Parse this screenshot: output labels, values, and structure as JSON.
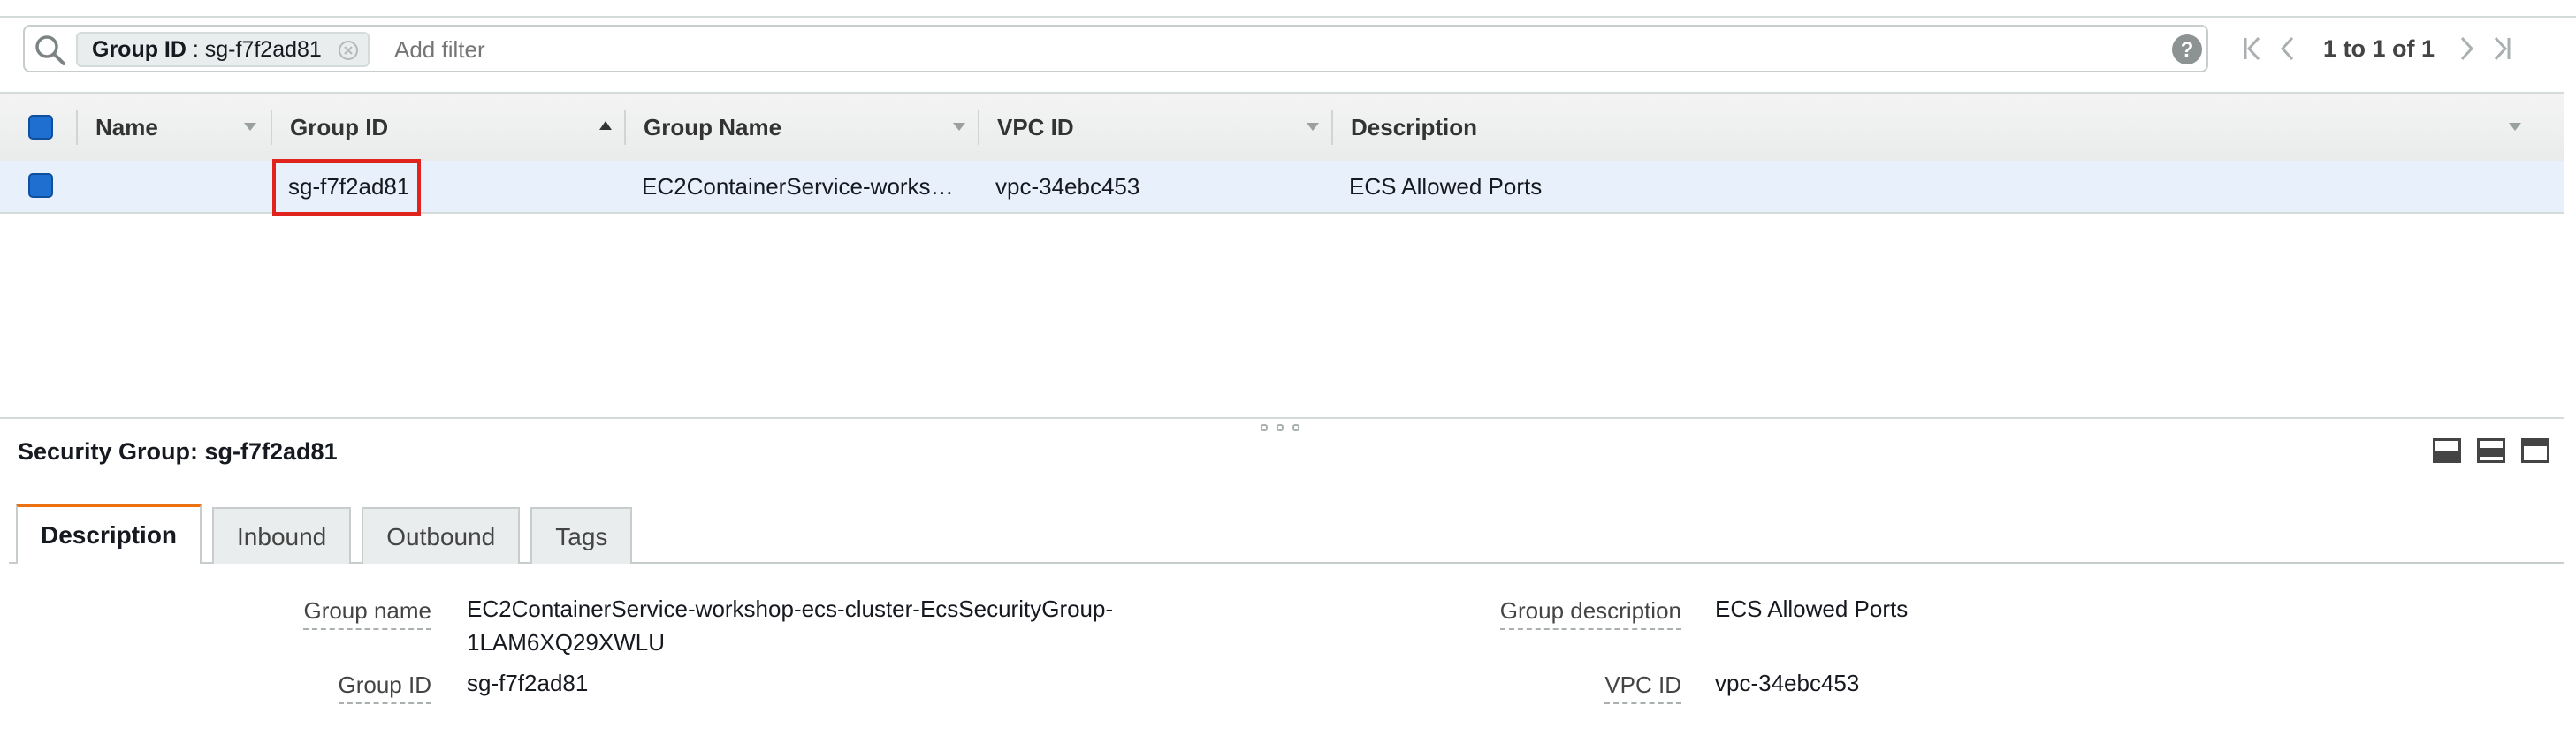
{
  "filter": {
    "chip_key": "Group ID",
    "chip_value": " : sg-f7f2ad81",
    "placeholder": "Add filter"
  },
  "pagination": {
    "text": "1 to 1 of 1"
  },
  "table": {
    "columns": [
      "Name",
      "Group ID",
      "Group Name",
      "VPC ID",
      "Description"
    ],
    "sorted_column": "Group ID",
    "rows": [
      {
        "name": "",
        "group_id": "sg-f7f2ad81",
        "group_name": "EC2ContainerService-workshop-ecs-cluster-EcsSecurityGroup-1LAM6XQ29XWLU",
        "vpc_id": "vpc-34ebc453",
        "description": "ECS Allowed Ports"
      }
    ]
  },
  "details": {
    "title": "Security Group: sg-f7f2ad81",
    "tabs": [
      "Description",
      "Inbound",
      "Outbound",
      "Tags"
    ],
    "active_tab": "Description",
    "fields": {
      "group_name_label": "Group name",
      "group_name_line1": "EC2ContainerService-workshop-ecs-cluster-EcsSecurityGroup-",
      "group_name_line2": "1LAM6XQ29XWLU",
      "group_id_label": "Group ID",
      "group_id": "sg-f7f2ad81",
      "group_description_label": "Group description",
      "group_description": "ECS Allowed Ports",
      "vpc_id_label": "VPC ID",
      "vpc_id": "vpc-34ebc453"
    }
  },
  "colors": {
    "selected_row": "#e7f0fb",
    "checkbox": "#1f6fd0",
    "active_tab_accent": "#ec7211",
    "highlight_box": "#e0241d"
  },
  "icons": [
    "search-icon",
    "clear-chip-icon",
    "help-icon",
    "first-page-icon",
    "prev-page-icon",
    "next-page-icon",
    "last-page-icon",
    "layout-bottom-icon",
    "layout-half-icon",
    "layout-top-icon"
  ]
}
